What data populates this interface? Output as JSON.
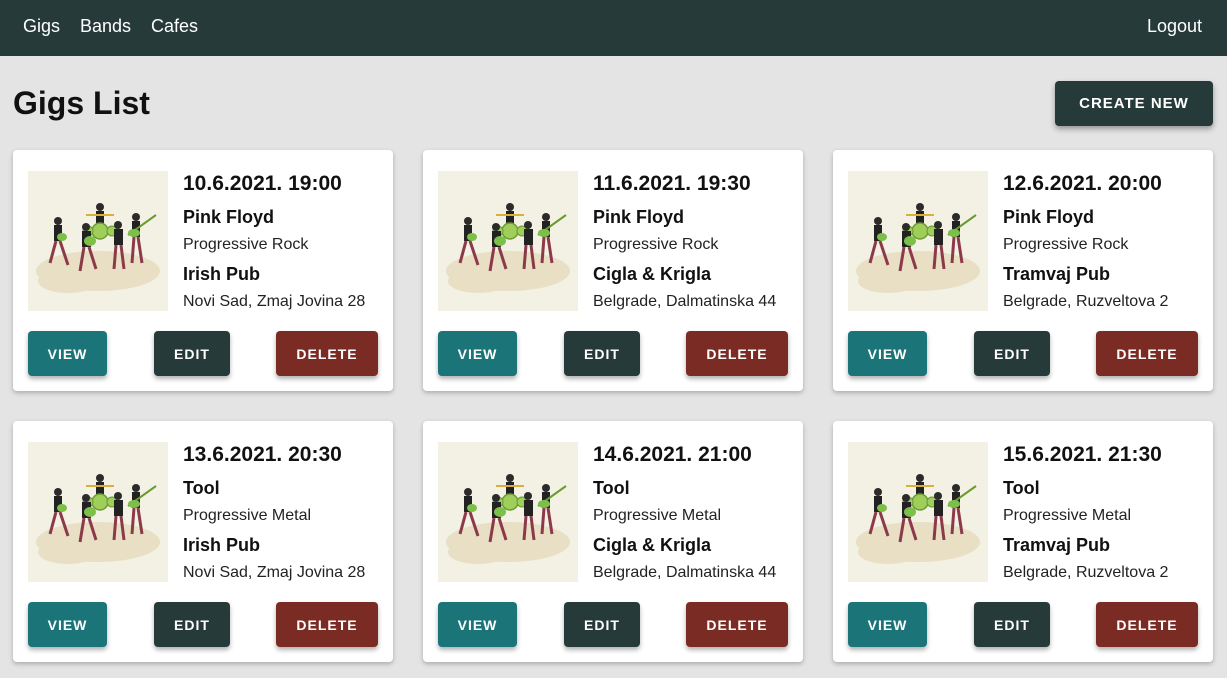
{
  "nav": {
    "gigs": "Gigs",
    "bands": "Bands",
    "cafes": "Cafes",
    "logout": "Logout"
  },
  "page": {
    "title": "Gigs List",
    "create_label": "CREATE NEW"
  },
  "buttons": {
    "view": "VIEW",
    "edit": "EDIT",
    "delete": "DELETE"
  },
  "colors": {
    "navbar": "#263a39",
    "view": "#1b7478",
    "edit": "#263a39",
    "delete": "#7a2c24",
    "background": "#e4e4e4"
  },
  "gigs": [
    {
      "date": "10.6.2021. 19:00",
      "band": "Pink Floyd",
      "genre": "Progressive Rock",
      "venue": "Irish Pub",
      "address": "Novi Sad, Zmaj Jovina 28"
    },
    {
      "date": "11.6.2021. 19:30",
      "band": "Pink Floyd",
      "genre": "Progressive Rock",
      "venue": "Cigla & Krigla",
      "address": "Belgrade, Dalmatinska 44"
    },
    {
      "date": "12.6.2021. 20:00",
      "band": "Pink Floyd",
      "genre": "Progressive Rock",
      "venue": "Tramvaj Pub",
      "address": "Belgrade, Ruzveltova 2"
    },
    {
      "date": "13.6.2021. 20:30",
      "band": "Tool",
      "genre": "Progressive Metal",
      "venue": "Irish Pub",
      "address": "Novi Sad, Zmaj Jovina 28"
    },
    {
      "date": "14.6.2021. 21:00",
      "band": "Tool",
      "genre": "Progressive Metal",
      "venue": "Cigla & Krigla",
      "address": "Belgrade, Dalmatinska 44"
    },
    {
      "date": "15.6.2021. 21:30",
      "band": "Tool",
      "genre": "Progressive Metal",
      "venue": "Tramvaj Pub",
      "address": "Belgrade, Ruzveltova 2"
    }
  ]
}
